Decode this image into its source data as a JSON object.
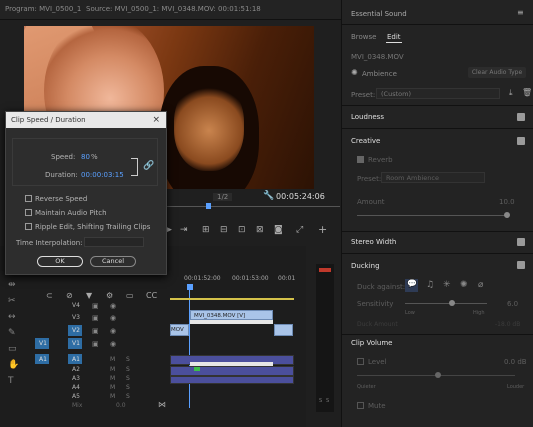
{
  "tabs": {
    "program": "Program: MVI_0500_1",
    "source": "Source: MVI_0500_1: MVI_0348.MOV: 00:01:51:18"
  },
  "program_monitor": {
    "zoom": "1/2",
    "timecode": "00:05:24:06"
  },
  "dialog": {
    "title": "Clip Speed / Duration",
    "close": "×",
    "speed_label": "Speed:",
    "speed_value": "80",
    "speed_unit": "%",
    "duration_label": "Duration:",
    "duration_value": "00:00:03:15",
    "options": [
      "Reverse Speed",
      "Maintain Audio Pitch",
      "Ripple Edit, Shifting Trailing Clips"
    ],
    "interp_label": "Time Interpolation:",
    "ok": "OK",
    "cancel": "Cancel"
  },
  "timeline": {
    "current_time": "00:05:24:06",
    "ruler": [
      "00:01:52:00",
      "00:01:53:00",
      "00:01"
    ],
    "video_tracks": [
      "V4",
      "V3",
      "V2",
      "V1"
    ],
    "audio_tracks": [
      "A1",
      "A2",
      "A3",
      "A4",
      "A5"
    ],
    "source_patch_v": "V1",
    "source_patch_a": "A1",
    "clip_label": "MVI_0348.MOV [V]",
    "clip_left_label": "MOV",
    "mix_label": "Mix",
    "mix_value": "0.0",
    "mute": "M",
    "solo": "S",
    "meter_labels": [
      "S",
      "S"
    ]
  },
  "essential_sound": {
    "panel_title": "Essential Sound",
    "tabs": [
      "Browse",
      "Edit"
    ],
    "clip_name": "MVI_0348.MOV",
    "type_label": "Ambience",
    "clear_button": "Clear Audio Type",
    "preset_label": "Preset:",
    "preset_value": "(Custom)",
    "sections": {
      "loudness": "Loudness",
      "creative": "Creative",
      "reverb": "Reverb",
      "reverb_preset_label": "Preset:",
      "reverb_preset": "Room Ambience",
      "amount_label": "Amount",
      "amount_value": "10.0",
      "stereo": "Stereo Width",
      "ducking": "Ducking",
      "duck_against": "Duck against:",
      "sensitivity": "Sensitivity",
      "sensitivity_value": "6.0",
      "low": "Low",
      "high": "High",
      "duck_amount": "Duck Amount",
      "duck_amount_value": "-18.0 dB",
      "clip_volume": "Clip Volume",
      "level": "Level",
      "level_value": "0.0 dB",
      "quieter": "Quieter",
      "louder": "Louder",
      "mute": "Mute"
    }
  },
  "colors": {
    "accent": "#5aa0ff",
    "clip_video": "#a9c4e8",
    "clip_audio": "#4b4f9c",
    "patch": "#2e6da4"
  }
}
